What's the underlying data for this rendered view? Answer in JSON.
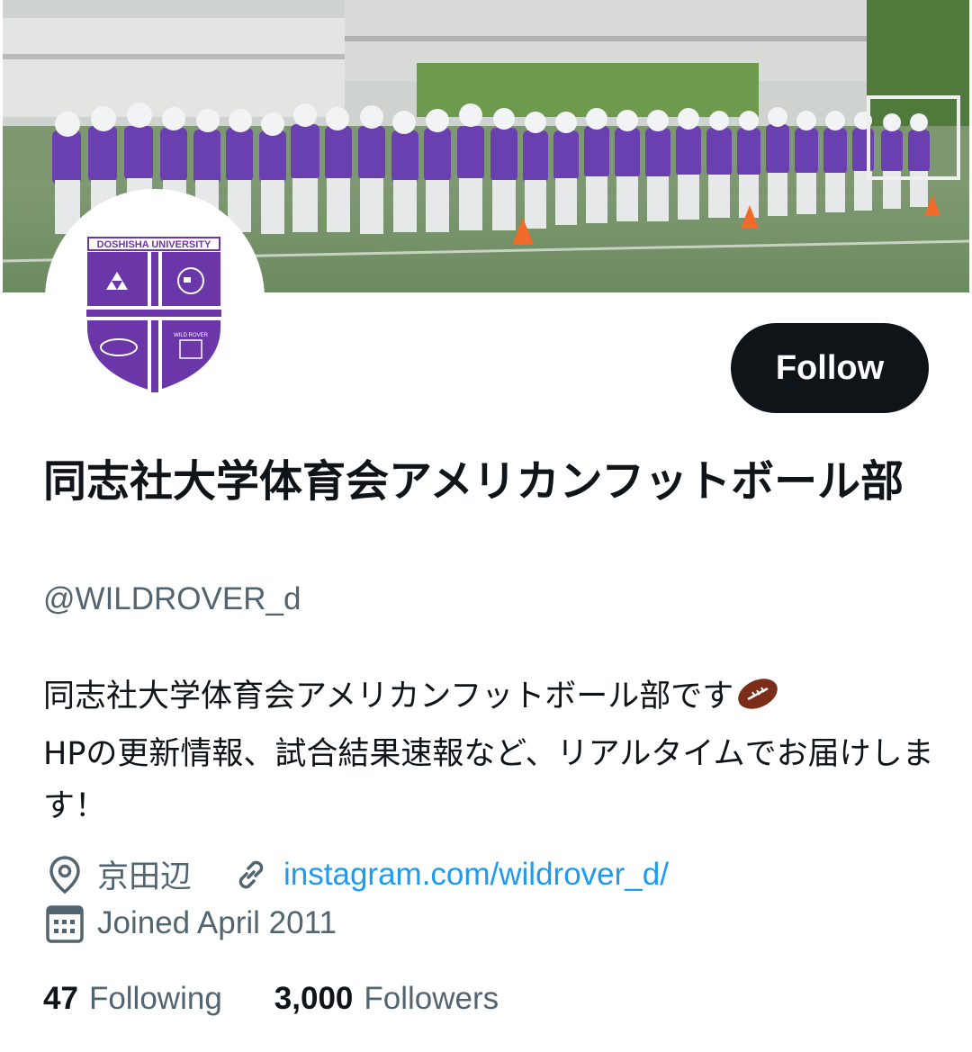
{
  "banner": {
    "alt": "team photo banner"
  },
  "avatar": {
    "shield_text": "DOSHISHA UNIVERSITY",
    "crest_text": "WILD ROVER"
  },
  "follow_label": "Follow",
  "profile": {
    "display_name": "同志社大学体育会アメリカンフットボール部",
    "handle": "@WILDROVER_d",
    "bio_line1": "同志社大学体育会アメリカンフットボール部です",
    "bio_line2": "HPの更新情報、試合結果速報など、リアルタイムでお届けします！",
    "location": "京田辺",
    "website": "instagram.com/wildrover_d/",
    "joined": "Joined April 2011"
  },
  "stats": {
    "following_count": "47",
    "following_label": "Following",
    "followers_count": "3,000",
    "followers_label": "Followers"
  },
  "colors": {
    "accent": "#1d9bf0",
    "muted": "#536471",
    "text": "#0f1419",
    "team_purple": "#6b36a8"
  },
  "icons": [
    "location-pin-icon",
    "link-icon",
    "calendar-icon",
    "american-football-emoji"
  ]
}
